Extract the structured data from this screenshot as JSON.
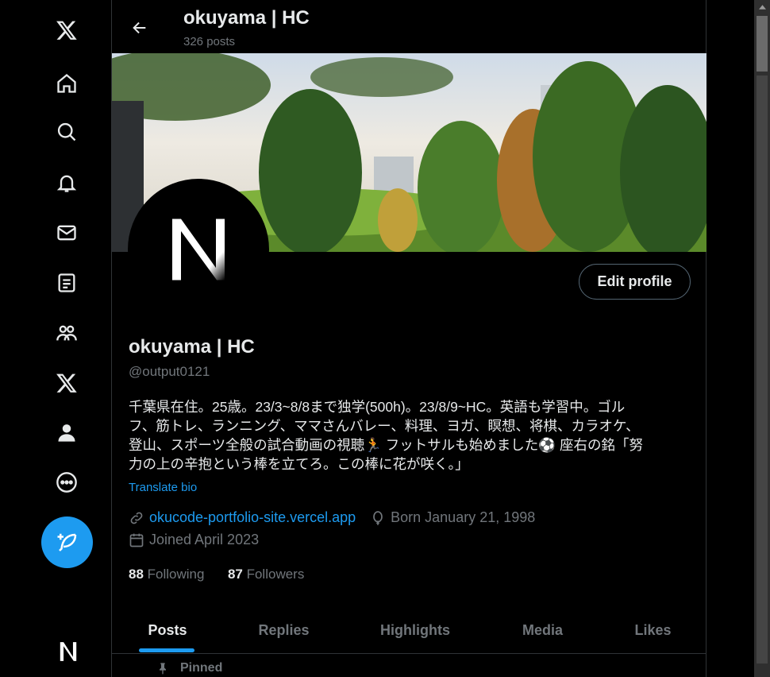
{
  "topbar": {
    "name": "okuyama | HC",
    "posts": "326 posts"
  },
  "profile": {
    "name": "okuyama | HC",
    "handle": "@output0121",
    "bio_lines": [
      "千葉県在住。25歳。23/3~8/8まで独学(500h)。23/8/9~HC。英語も学習中。ゴル",
      "フ、筋トレ、ランニング、ママさんバレー、料理、ヨガ、瞑想、将棋、カラオケ、",
      "登山、スポーツ全般の試合動画の視聴🏃 フットサルも始めました⚽ 座右の銘「努",
      "力の上の辛抱という棒を立てろ。この棒に花が咲く。」"
    ],
    "translate": "Translate bio",
    "website": "okucode-portfolio-site.vercel.app",
    "born": "Born January 21, 1998",
    "joined": "Joined April 2023",
    "following_count": "88",
    "following_label": "Following",
    "followers_count": "87",
    "followers_label": "Followers",
    "edit_label": "Edit profile"
  },
  "tabs": [
    "Posts",
    "Replies",
    "Highlights",
    "Media",
    "Likes"
  ],
  "pinned_label": "Pinned",
  "colors": {
    "accent": "#1d9bf0",
    "text": "#e7e9ea",
    "muted": "#71767b",
    "border": "#2f3336"
  },
  "nav_icons": [
    "x-logo-icon",
    "home-icon",
    "search-icon",
    "bell-icon",
    "mail-icon",
    "lists-icon",
    "communities-icon",
    "premium-x-icon",
    "profile-icon",
    "more-icon",
    "compose-icon"
  ]
}
